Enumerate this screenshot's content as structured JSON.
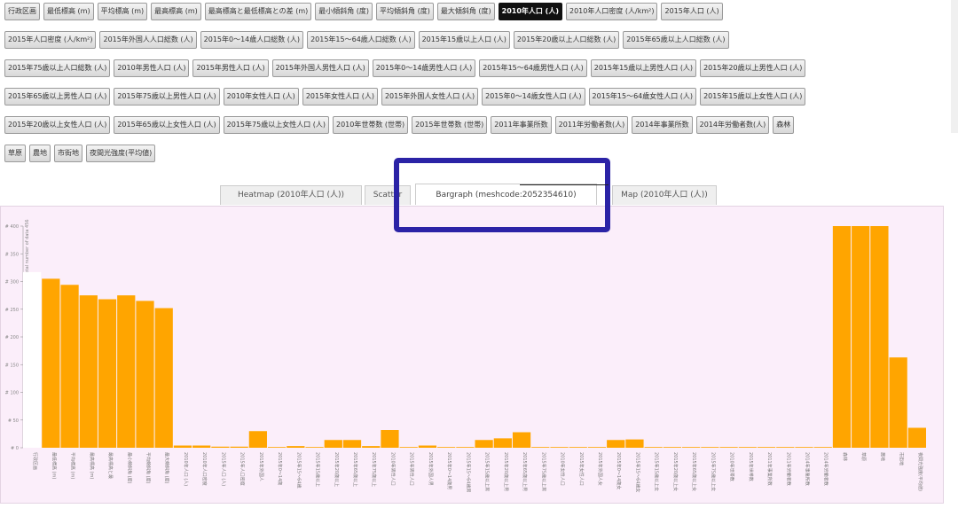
{
  "attribute_rows": [
    [
      "行政区画",
      "最低標高 (m)",
      "平均標高 (m)",
      "最高標高 (m)",
      "最高標高と最低標高との差 (m)",
      "最小傾斜角 (度)",
      "平均傾斜角 (度)",
      "最大傾斜角 (度)",
      "2010年人口 (人)",
      "2010年人口密度 (人/km²)",
      "2015年人口 (人)"
    ],
    [
      "2015年人口密度 (人/km²)",
      "2015年外国人人口総数 (人)",
      "2015年0～14歳人口総数 (人)",
      "2015年15～64歳人口総数 (人)",
      "2015年15歳以上人口 (人)",
      "2015年20歳以上人口総数 (人)",
      "2015年65歳以上人口総数 (人)"
    ],
    [
      "2015年75歳以上人口総数 (人)",
      "2010年男性人口 (人)",
      "2015年男性人口 (人)",
      "2015年外国人男性人口 (人)",
      "2015年0～14歳男性人口 (人)",
      "2015年15～64歳男性人口 (人)",
      "2015年15歳以上男性人口 (人)",
      "2015年20歳以上男性人口 (人)"
    ],
    [
      "2015年65歳以上男性人口 (人)",
      "2015年75歳以上男性人口 (人)",
      "2010年女性人口 (人)",
      "2015年女性人口 (人)",
      "2015年外国人女性人口 (人)",
      "2015年0～14歳女性人口 (人)",
      "2015年15～64歳女性人口 (人)",
      "2015年15歳以上女性人口 (人)"
    ],
    [
      "2015年20歳以上女性人口 (人)",
      "2015年65歳以上女性人口 (人)",
      "2015年75歳以上女性人口 (人)",
      "2010年世帯数 (世帯)",
      "2015年世帯数 (世帯)",
      "2011年事業所数",
      "2011年労働者数(人)",
      "2014年事業所数",
      "2014年労働者数(人)",
      "森林"
    ],
    [
      "草原",
      "農地",
      "市街地",
      "夜間光強度(平均値)"
    ]
  ],
  "active_attribute": "2010年人口 (人)",
  "tabs": [
    {
      "label": "Heatmap (2010年人口 (人))",
      "active": false
    },
    {
      "label": "Scatter",
      "active": false
    },
    {
      "label": "Bargraph (meshcode:2052354610)",
      "active": true
    },
    {
      "label": "Map (2010年人口 (人))",
      "active": false
    }
  ],
  "chart_data": {
    "type": "bar",
    "title": "",
    "ylabel": "Ranking of total number of data 456",
    "ylim": [
      400,
      0
    ],
    "yticks": [
      400,
      350,
      300,
      250,
      200,
      150,
      100,
      50,
      0
    ],
    "bar_color": "#ffa500",
    "categories": [
      "行政区画",
      "最低標高 (m)",
      "平均標高 (m)",
      "最高標高 (m)",
      "最高標高と最",
      "最小傾斜角 (度)",
      "平均傾斜角 (度)",
      "最大傾斜角 (度)",
      "2010年人口 (人)",
      "2010年人口密度",
      "2015年人口 (人)",
      "2015年人口密度",
      "2015年外国人",
      "2015年0～14歳",
      "2015年15～64歳",
      "2015年15歳以上",
      "2015年20歳以上",
      "2015年65歳以上",
      "2015年75歳以上",
      "2010年男性人口",
      "2015年男性人口",
      "2015年外国人男",
      "2015年0～14歳男",
      "2015年15～64歳男",
      "2015年15歳以上男",
      "2015年20歳以上男",
      "2015年65歳以上男",
      "2015年75歳以上男",
      "2010年女性人口",
      "2015年女性人口",
      "2015年外国人女",
      "2015年0～14歳女",
      "2015年15～64歳女",
      "2015年15歳以上女",
      "2015年20歳以上女",
      "2015年65歳以上女",
      "2015年75歳以上女",
      "2010年世帯数",
      "2015年世帯数",
      "2011年事業所数",
      "2011年労働者数",
      "2014年事業所数",
      "2014年労働者数",
      "森林",
      "草原",
      "農地",
      "市街地",
      "夜間光強度(平均値)"
    ],
    "values": [
      317,
      305,
      294,
      275,
      268,
      275,
      265,
      252,
      4,
      4,
      2,
      2,
      30,
      1,
      3,
      1,
      14,
      14,
      3,
      32,
      0,
      4,
      0,
      1,
      14,
      17,
      28,
      1,
      1,
      0,
      1,
      14,
      15,
      1,
      1,
      0,
      1,
      1,
      0,
      0,
      0,
      0,
      0,
      400,
      400,
      400,
      163,
      36
    ]
  }
}
